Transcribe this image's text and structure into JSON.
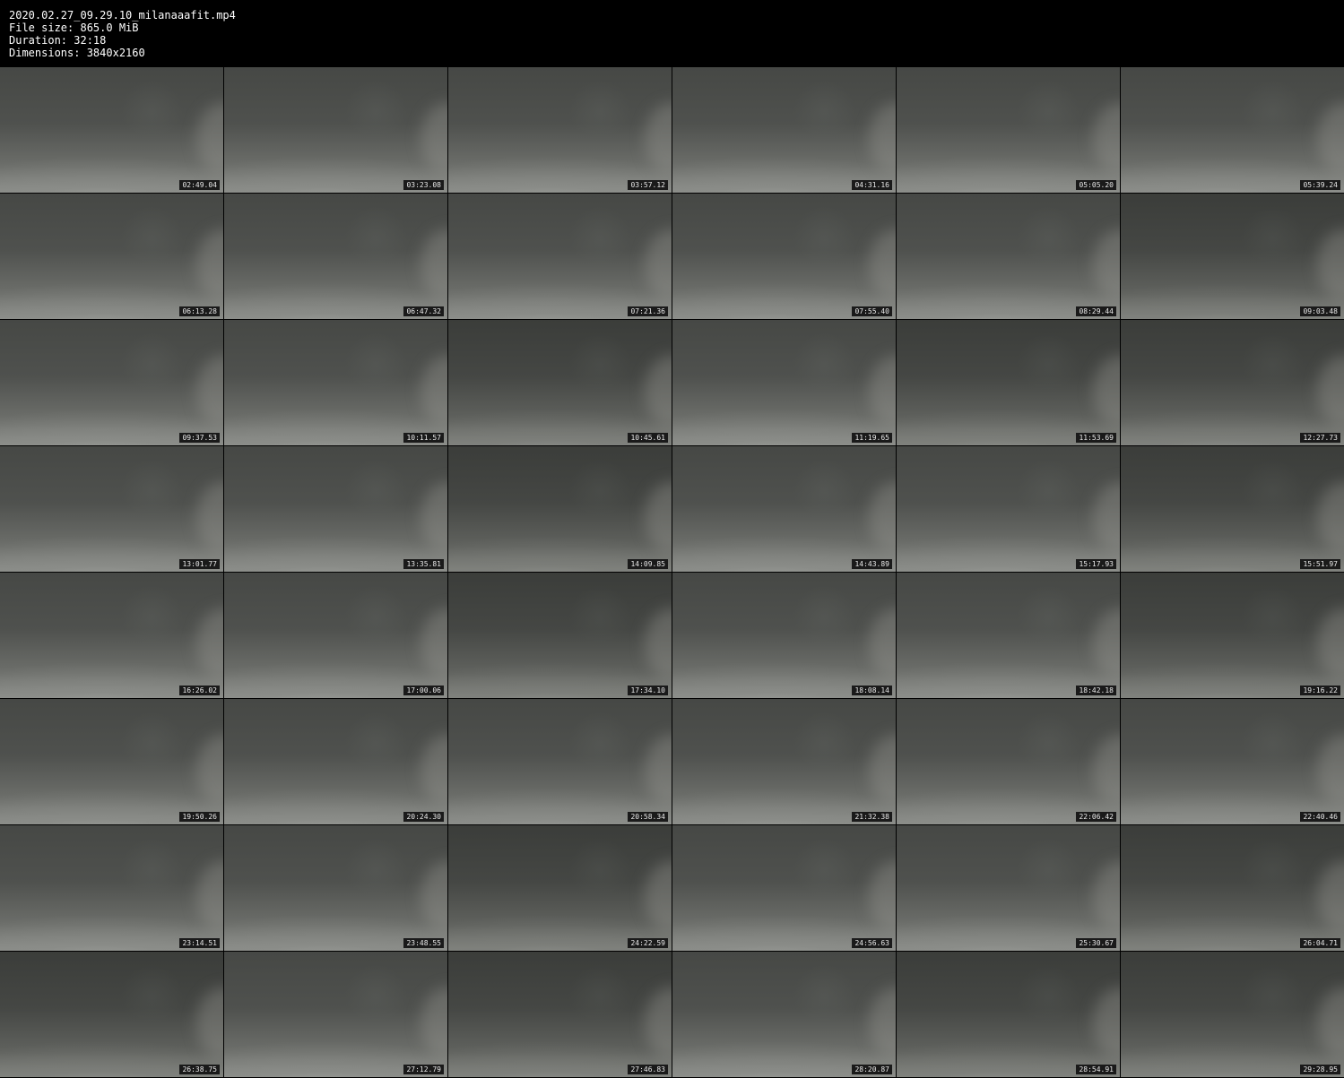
{
  "header": {
    "filename": "2020.02.27_09.29.10_milanaaafit.mp4",
    "file_size": "File size: 865.0 MiB",
    "duration": "Duration: 32:18",
    "dimensions": "Dimensions: 3840x2160"
  },
  "thumbnails": [
    "02:49.04",
    "03:23.08",
    "03:57.12",
    "04:31.16",
    "05:05.20",
    "05:39.24",
    "06:13.28",
    "06:47.32",
    "07:21.36",
    "07:55.40",
    "08:29.44",
    "09:03.48",
    "09:37.53",
    "10:11.57",
    "10:45.61",
    "11:19.65",
    "11:53.69",
    "12:27.73",
    "13:01.77",
    "13:35.81",
    "14:09.85",
    "14:43.89",
    "15:17.93",
    "15:51.97",
    "16:26.02",
    "17:00.06",
    "17:34.10",
    "18:08.14",
    "18:42.18",
    "19:16.22",
    "19:50.26",
    "20:24.30",
    "20:58.34",
    "21:32.38",
    "22:06.42",
    "22:40.46",
    "23:14.51",
    "23:48.55",
    "24:22.59",
    "24:56.63",
    "25:30.67",
    "26:04.71",
    "26:38.75",
    "27:12.79",
    "27:46.83",
    "28:20.87",
    "28:54.91",
    "29:28.95"
  ]
}
